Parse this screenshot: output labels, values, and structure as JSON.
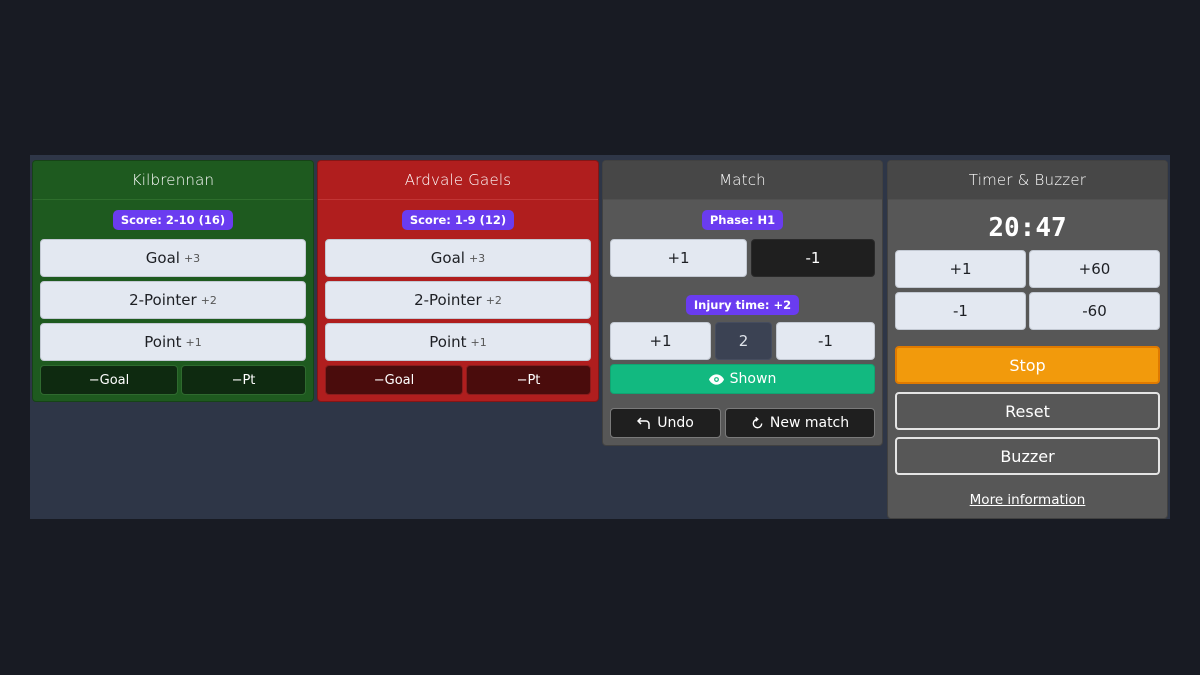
{
  "team_home": {
    "name": "Kilbrennan",
    "score_badge": "Score: 2-10 (16)",
    "goal_label": "Goal",
    "goal_value": "+3",
    "two_pointer_label": "2-Pointer",
    "two_pointer_value": "+2",
    "point_label": "Point",
    "point_value": "+1",
    "minus_goal": "−Goal",
    "minus_point": "−Pt",
    "color": "#1e5a1f"
  },
  "team_away": {
    "name": "Ardvale Gaels",
    "score_badge": "Score: 1-9 (12)",
    "goal_label": "Goal",
    "goal_value": "+3",
    "two_pointer_label": "2-Pointer",
    "two_pointer_value": "+2",
    "point_label": "Point",
    "point_value": "+1",
    "minus_goal": "−Goal",
    "minus_point": "−Pt",
    "color": "#b01e1e"
  },
  "match": {
    "title": "Match",
    "phase_badge": "Phase: H1",
    "phase_plus": "+1",
    "phase_minus": "-1",
    "injury_badge": "Injury time: +2",
    "injury_plus": "+1",
    "injury_value": "2",
    "injury_minus": "-1",
    "shown_label": "Shown",
    "undo_label": "Undo",
    "new_match_label": "New match",
    "icons": [
      "eye-icon",
      "undo-arrow-icon",
      "refresh-icon"
    ]
  },
  "timer": {
    "title": "Timer & Buzzer",
    "clock": "20:47",
    "plus1": "+1",
    "plus60": "+60",
    "minus1": "-1",
    "minus60": "-60",
    "stop_label": "Stop",
    "reset_label": "Reset",
    "buzzer_label": "Buzzer",
    "more_info": "More information",
    "accent": "#f29a0c"
  }
}
